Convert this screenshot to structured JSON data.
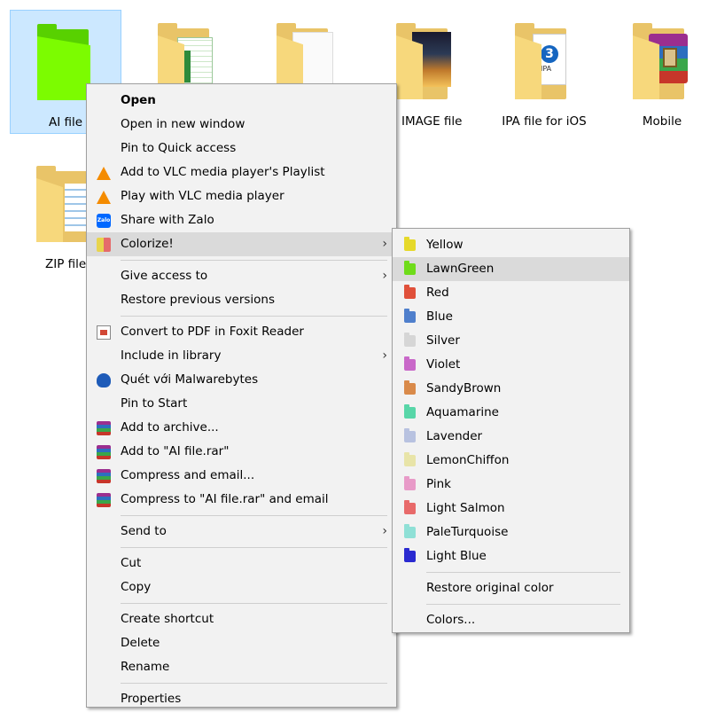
{
  "files": [
    {
      "label": "AI file",
      "selected": true
    },
    {
      "label": "",
      "thumb": "spreadsheet"
    },
    {
      "label": "",
      "thumb": "document"
    },
    {
      "label": "IMAGE file",
      "thumb": "image"
    },
    {
      "label": "IPA file for iOS",
      "thumb": "ipa"
    },
    {
      "label": "Mobile",
      "thumb": "rar"
    },
    {
      "label": "ZIP file",
      "thumb": "zip"
    }
  ],
  "context_menu": {
    "items": [
      {
        "label": "Open",
        "icon": "",
        "bold": true
      },
      {
        "label": "Open in new window",
        "icon": ""
      },
      {
        "label": "Pin to Quick access",
        "icon": ""
      },
      {
        "label": "Add to VLC media player's Playlist",
        "icon": "vlc-icon"
      },
      {
        "label": "Play with VLC media player",
        "icon": "vlc-icon"
      },
      {
        "label": "Share with Zalo",
        "icon": "zalo-icon",
        "icon_text": "Zalo"
      },
      {
        "label": "Colorize!",
        "icon": "colorize-icon",
        "submenu": true,
        "highlighted": true
      },
      {
        "label": "Give access to",
        "icon": "",
        "submenu": true
      },
      {
        "label": "Restore previous versions",
        "icon": ""
      },
      {
        "label": "Convert to PDF in Foxit Reader",
        "icon": "pdf-icon"
      },
      {
        "label": "Include in library",
        "icon": "",
        "submenu": true
      },
      {
        "label": "Quét với Malwarebytes",
        "icon": "malwarebytes-icon"
      },
      {
        "label": "Pin to Start",
        "icon": ""
      },
      {
        "label": "Add to archive...",
        "icon": "winrar-icon"
      },
      {
        "label": "Add to \"AI file.rar\"",
        "icon": "winrar-icon"
      },
      {
        "label": "Compress and email...",
        "icon": "winrar-icon"
      },
      {
        "label": "Compress to \"AI file.rar\" and email",
        "icon": "winrar-icon"
      },
      {
        "label": "Send to",
        "icon": "",
        "submenu": true
      },
      {
        "label": "Cut",
        "icon": ""
      },
      {
        "label": "Copy",
        "icon": ""
      },
      {
        "label": "Create shortcut",
        "icon": ""
      },
      {
        "label": "Delete",
        "icon": ""
      },
      {
        "label": "Rename",
        "icon": ""
      },
      {
        "label": "Properties",
        "icon": ""
      }
    ]
  },
  "colorize_menu": {
    "colors": [
      {
        "label": "Yellow",
        "color": "#e6d92a"
      },
      {
        "label": "LawnGreen",
        "color": "#6fdc1a",
        "highlighted": true
      },
      {
        "label": "Red",
        "color": "#e0503a"
      },
      {
        "label": "Blue",
        "color": "#4f7fcc"
      },
      {
        "label": "Silver",
        "color": "#d6d6d6"
      },
      {
        "label": "Violet",
        "color": "#c968c9"
      },
      {
        "label": "SandyBrown",
        "color": "#d98a4a"
      },
      {
        "label": "Aquamarine",
        "color": "#58d6a8"
      },
      {
        "label": "Lavender",
        "color": "#b8c2e0"
      },
      {
        "label": "LemonChiffon",
        "color": "#e8e4a8"
      },
      {
        "label": "Pink",
        "color": "#e89ac8"
      },
      {
        "label": "Light Salmon",
        "color": "#e86a6a"
      },
      {
        "label": "PaleTurquoise",
        "color": "#8fe0d6"
      },
      {
        "label": "Light Blue",
        "color": "#2a2ad0"
      }
    ],
    "restore_label": "Restore original color",
    "colors_label": "Colors..."
  },
  "submenu_arrow": "›"
}
